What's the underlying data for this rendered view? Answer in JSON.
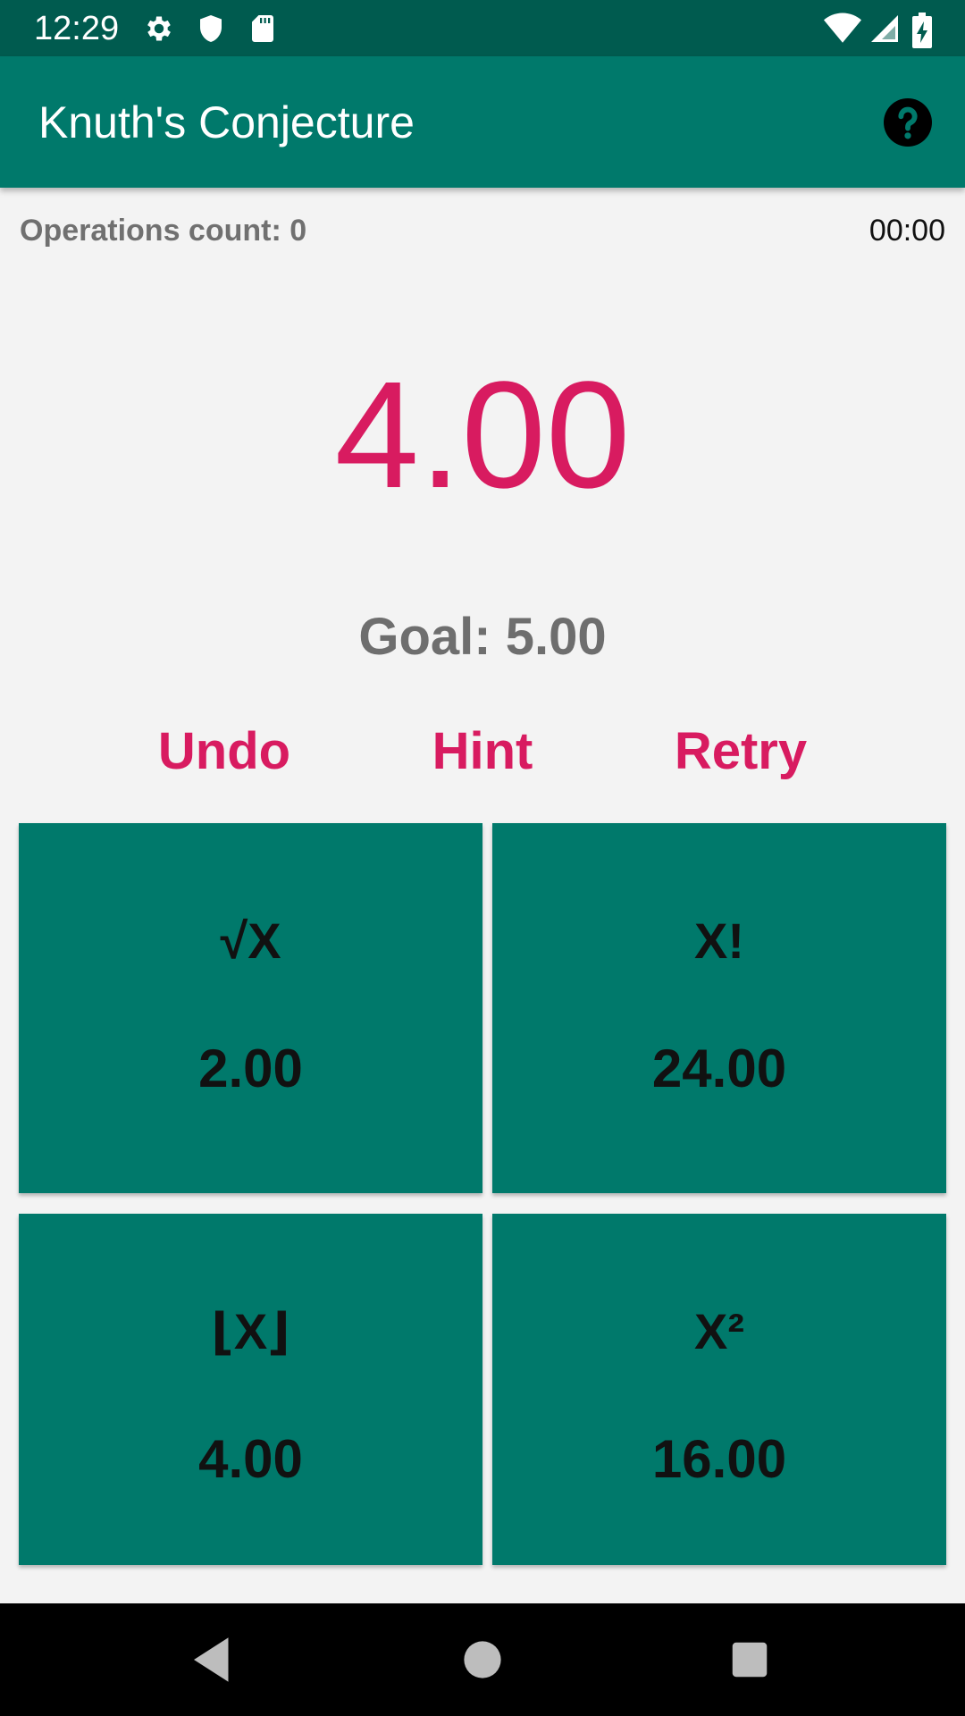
{
  "status_bar": {
    "time": "12:29",
    "left_icons": [
      "gear-icon",
      "shield-icon",
      "sd-card-icon"
    ],
    "right_icons": [
      "wifi-icon",
      "cell-signal-icon",
      "battery-charging-icon"
    ]
  },
  "app_bar": {
    "title": "Knuth's Conjecture",
    "help_icon": "question-circle-icon"
  },
  "stats": {
    "operations_count": "Operations count: 0",
    "timer": "00:00"
  },
  "game": {
    "current_value": "4.00",
    "goal": "Goal: 5.00"
  },
  "actions": {
    "undo": "Undo",
    "hint": "Hint",
    "retry": "Retry"
  },
  "operations": [
    {
      "symbol": "√X",
      "result": "2.00"
    },
    {
      "symbol": "X!",
      "result": "24.00"
    },
    {
      "symbol": "⌊X⌋",
      "result": "4.00"
    },
    {
      "symbol": "X²",
      "result": "16.00"
    }
  ],
  "nav_bar": {
    "icons": [
      "back-icon",
      "home-icon",
      "recents-icon"
    ]
  },
  "colors": {
    "primary": "#00796b",
    "primary_dark": "#005b4f",
    "accent": "#d81b60"
  }
}
